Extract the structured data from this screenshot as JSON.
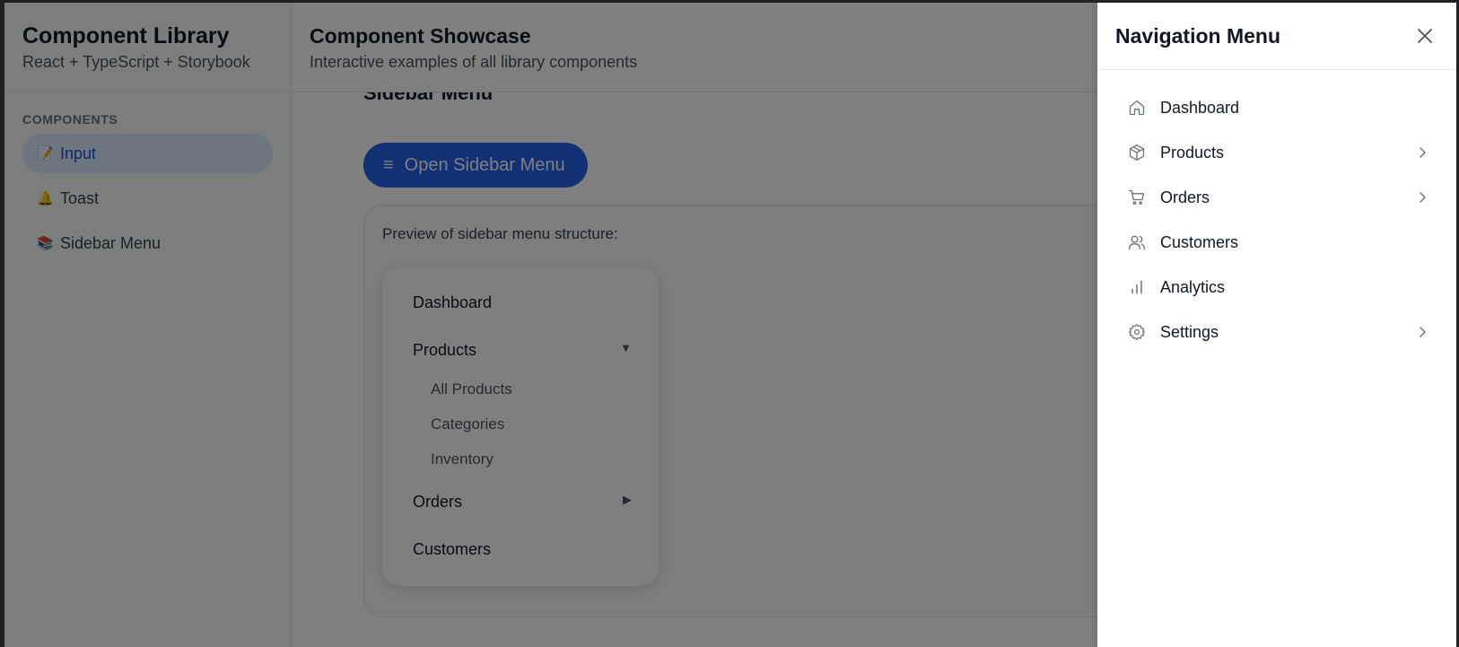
{
  "app": {
    "title": "Component Library",
    "subtitle": "React + TypeScript + Storybook"
  },
  "sidebar": {
    "section_label": "COMPONENTS",
    "items": [
      {
        "icon": "memo-emoji",
        "emoji": "📝",
        "label": "Input",
        "active": true
      },
      {
        "icon": "bell-emoji",
        "emoji": "🔔",
        "label": "Toast",
        "active": false
      },
      {
        "icon": "books-emoji",
        "emoji": "📚",
        "label": "Sidebar Menu",
        "active": false
      }
    ]
  },
  "main": {
    "title": "Component Showcase",
    "subtitle": "Interactive examples of all library components",
    "section_title": "Sidebar Menu",
    "open_button_icon": "≡",
    "open_button": "Open Sidebar Menu",
    "preview_caption": "Preview of sidebar menu structure:",
    "preview_menu": {
      "dashboard": "Dashboard",
      "products": "Products",
      "products_arrow": "▼",
      "products_children": [
        "All Products",
        "Categories",
        "Inventory"
      ],
      "orders": "Orders",
      "orders_arrow": "▶",
      "customers": "Customers"
    }
  },
  "drawer": {
    "title": "Navigation Menu",
    "items": [
      {
        "icon": "home-icon",
        "label": "Dashboard",
        "has_children": false
      },
      {
        "icon": "box-icon",
        "label": "Products",
        "has_children": true
      },
      {
        "icon": "cart-icon",
        "label": "Orders",
        "has_children": true
      },
      {
        "icon": "users-icon",
        "label": "Customers",
        "has_children": false
      },
      {
        "icon": "bar-chart-icon",
        "label": "Analytics",
        "has_children": false
      },
      {
        "icon": "gear-icon",
        "label": "Settings",
        "has_children": true
      }
    ]
  },
  "colors": {
    "accent": "#2563eb",
    "active_bg": "#dbeafe",
    "active_text": "#1d4ed8",
    "overlay": "rgba(0,0,0,0.5)"
  }
}
